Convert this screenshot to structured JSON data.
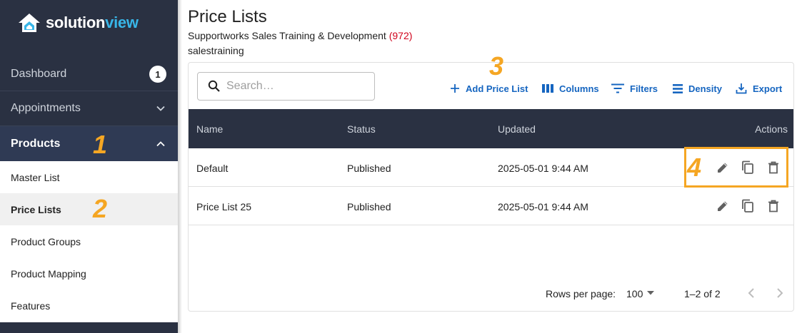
{
  "brand": {
    "name_a": "solution",
    "name_b": "view",
    "accent": "#38b6e8"
  },
  "sidebar": {
    "dashboard": {
      "label": "Dashboard",
      "badge": "1"
    },
    "appointments": {
      "label": "Appointments"
    },
    "products": {
      "label": "Products",
      "items": [
        {
          "label": "Master List"
        },
        {
          "label": "Price Lists"
        },
        {
          "label": "Product Groups"
        },
        {
          "label": "Product Mapping"
        },
        {
          "label": "Features"
        }
      ]
    }
  },
  "markers": {
    "m1": "1",
    "m2": "2",
    "m3": "3",
    "m4": "4"
  },
  "header": {
    "title": "Price Lists",
    "org": "Supportworks Sales Training & Development",
    "org_phone": "(972)",
    "user": "salestraining"
  },
  "toolbar": {
    "search_placeholder": "Search…",
    "add": "Add Price List",
    "columns": "Columns",
    "filters": "Filters",
    "density": "Density",
    "export": "Export"
  },
  "table": {
    "columns": [
      "Name",
      "Status",
      "Updated",
      "Actions"
    ],
    "rows": [
      {
        "name": "Default",
        "status": "Published",
        "updated": "2025-05-01 9:44 AM"
      },
      {
        "name": "Price List 25",
        "status": "Published",
        "updated": "2025-05-01 9:44 AM"
      }
    ]
  },
  "pagination": {
    "rows_label": "Rows per page:",
    "rows_value": "100",
    "range": "1–2 of 2"
  },
  "colors": {
    "sidebar_bg": "#2a3142",
    "link": "#1565c0",
    "marker": "#f5a623",
    "phone": "#d0021b"
  }
}
